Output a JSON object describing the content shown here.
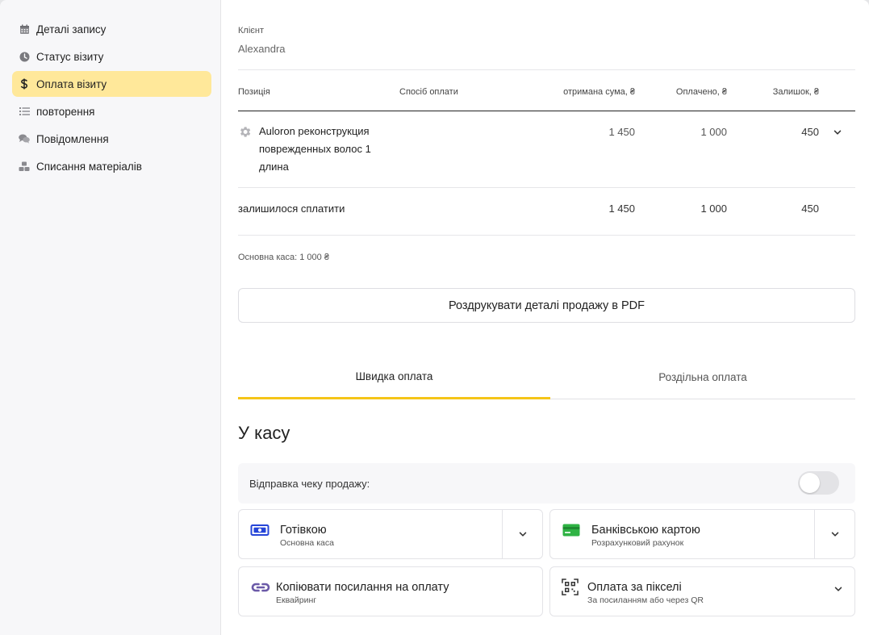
{
  "sidebar": {
    "items": [
      {
        "label": "Деталі запису",
        "icon": "calendar-icon"
      },
      {
        "label": "Статус візиту",
        "icon": "clock-icon"
      },
      {
        "label": "Оплата візиту",
        "icon": "dollar-icon",
        "active": true
      },
      {
        "label": "повторення",
        "icon": "list-icon"
      },
      {
        "label": "Повідомлення",
        "icon": "chat-icon"
      },
      {
        "label": "Списання матеріалів",
        "icon": "materials-icon"
      }
    ]
  },
  "client": {
    "label": "Клієнт",
    "name": "Alexandra"
  },
  "table": {
    "headers": {
      "position": "Позиція",
      "payment_method": "Спосіб оплати",
      "received": "отримана сума, ₴",
      "paid": "Оплачено, ₴",
      "balance": "Залишок, ₴"
    },
    "rows": [
      {
        "name": "Auloron реконструкция поврежденных волос 1 длина",
        "received": "1 450",
        "paid": "1 000",
        "balance": "450"
      }
    ],
    "total": {
      "label": "залишилося сплатити",
      "received": "1 450",
      "paid": "1 000",
      "balance": "450"
    }
  },
  "kasa_note": "Основна каса: 1 000 ₴",
  "pdf_button": "Роздрукувати деталі продажу в PDF",
  "tabs": {
    "quick": "Швидка оплата",
    "split": "Роздільна оплата"
  },
  "cashier": {
    "title": "У касу",
    "receipt_label": "Відправка чеку продажу:",
    "receipt_enabled": false
  },
  "payment_options": [
    {
      "title": "Готівкою",
      "subtitle": "Основна каса",
      "icon": "cash-icon",
      "color": "#2545d8"
    },
    {
      "title": "Банківською картою",
      "subtitle": "Розрахунковий рахунок",
      "icon": "card-icon",
      "color": "#2fb344"
    },
    {
      "title": "Копіювати посилання на оплату",
      "subtitle": "Еквайринг",
      "icon": "link-icon",
      "color": "#6b5aa8"
    },
    {
      "title": "Оплата за пікселі",
      "subtitle": "За посиланням або через QR",
      "icon": "qr-scan-icon",
      "color": "#333333"
    }
  ]
}
